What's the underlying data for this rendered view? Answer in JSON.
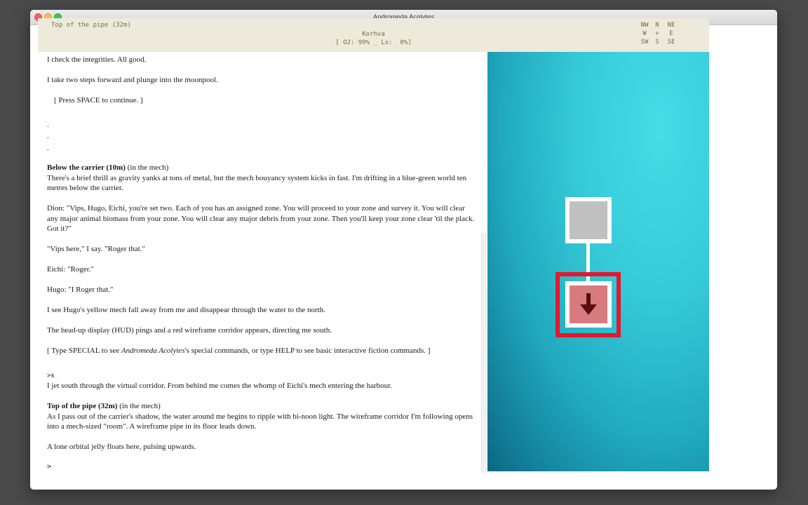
{
  "window": {
    "title": "Andromeda Acolytes"
  },
  "status": {
    "location": "Top of the pipe (32m)",
    "character": "Korhva",
    "stats": "[ O2: 99% _ Lx:  0%]",
    "compass": [
      "NW",
      "N",
      "NE",
      "W",
      "+",
      "E",
      "SW",
      "S",
      "SE"
    ]
  },
  "story": {
    "p1": "I check the integrities. All good.",
    "p2": "I take two steps forward and plunge into the moonpool.",
    "p3": "[ Press SPACE to continue. ]",
    "dot": ".",
    "room1_name": "Below the carrier (10m)",
    "room1_suffix": " (in the mech)",
    "room1_desc": "There's a brief thrill as gravity yanks at tons of metal, but the mech bouyancy system kicks in fast. I'm drifting in a blue-green world ten metres below the carrier.",
    "p_dion": "Dion: \"Vips, Hugo, Eichi, you're set two. Each of you has an assigned zone. You will proceed to your zone and survey it. You will clear any major animal biomass from your zone. You will clear any major debris from your zone. Then you'll keep your zone clear 'til the plack. Got it?\"",
    "p_vips": "\"Vips here,\" I say. \"Roger that.\"",
    "p_eichi": "Eichi: \"Roger.\"",
    "p_hugo": "Hugo: \"I Roger that.\"",
    "p_yellow": "I see Hugo's yellow mech fall away from me and disappear through the water to the north.",
    "p_hud": "The head-up display (HUD) pings and a red wireframe corridor appears, directing me south.",
    "special_pre": "[ Type SPECIAL to see ",
    "special_game": "Andromeda Acolytes",
    "special_post": "'s special commands, or type HELP to see basic interactive fiction commands. ]",
    "cmd_s": ">s",
    "p_jet": "I jet south through the virtual corridor. From behind me comes the whomp of Eichi's mech entering the harbour.",
    "room2_name": "Top of the pipe (32m)",
    "room2_suffix": " (in the mech)",
    "room2_desc": "As I pass out of the carrier's shadow, the water around me begins to ripple with bi-noon light. The wireframe corridor I'm following opens into a mech-sized \"room\". A wireframe pipe in its floor leads down.",
    "p_jelly": "A lone orbital jelly floats here, pulsing upwards.",
    "prompt": ">"
  },
  "map": {
    "icon": "down-arrow-icon",
    "highlight_color": "#e4172c",
    "current_room_color": "#d87b7e",
    "visited_room_color": "#c0c0c0",
    "water_color": "#36cad8"
  }
}
